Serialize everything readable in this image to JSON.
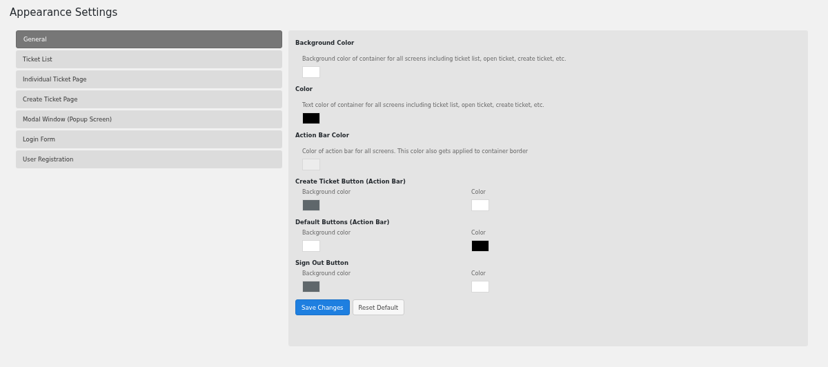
{
  "title": "Appearance Settings",
  "nav": [
    {
      "label": "General",
      "selected": true
    },
    {
      "label": "Ticket List",
      "selected": false
    },
    {
      "label": "Individual Ticket Page",
      "selected": false
    },
    {
      "label": "Create Ticket Page",
      "selected": false
    },
    {
      "label": "Modal Window (Popup Screen)",
      "selected": false
    },
    {
      "label": "Login Form",
      "selected": false
    },
    {
      "label": "User Registration",
      "selected": false
    }
  ],
  "settings": [
    {
      "kind": "single",
      "title": "Background Color",
      "description": "Background color of container for all screens including ticket list, open ticket, create ticket, etc.",
      "color": "#ffffff"
    },
    {
      "kind": "single",
      "title": "Color",
      "description": "Text color of container for all screens including ticket list, open ticket, create ticket, etc.",
      "color": "#000000"
    },
    {
      "kind": "single",
      "title": "Action Bar Color",
      "description": "Color of action bar for all screens. This color also gets applied to container border",
      "color": "#ececec"
    },
    {
      "kind": "pair",
      "title": "Create Ticket Button (Action Bar)",
      "fields": [
        {
          "label": "Background color",
          "color": "#5f676b"
        },
        {
          "label": "Color",
          "color": "#ffffff"
        }
      ]
    },
    {
      "kind": "pair",
      "title": "Default Buttons (Action Bar)",
      "fields": [
        {
          "label": "Background color",
          "color": "#ffffff"
        },
        {
          "label": "Color",
          "color": "#000000"
        }
      ]
    },
    {
      "kind": "pair",
      "title": "Sign Out Button",
      "fields": [
        {
          "label": "Background color",
          "color": "#5f676b"
        },
        {
          "label": "Color",
          "color": "#ffffff"
        }
      ]
    }
  ],
  "buttons": [
    {
      "label": "Save Changes",
      "kind": "primary"
    },
    {
      "label": "Reset Default",
      "kind": "secondary"
    }
  ]
}
